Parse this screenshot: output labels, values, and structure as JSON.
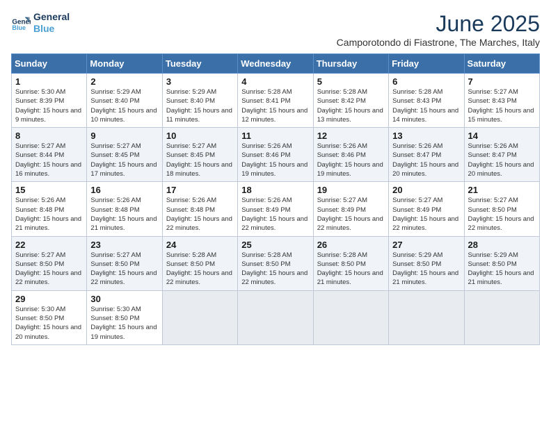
{
  "logo": {
    "line1": "General",
    "line2": "Blue"
  },
  "calendar": {
    "title": "June 2025",
    "subtitle": "Camporotondo di Fiastrone, The Marches, Italy"
  },
  "headers": [
    "Sunday",
    "Monday",
    "Tuesday",
    "Wednesday",
    "Thursday",
    "Friday",
    "Saturday"
  ],
  "weeks": [
    [
      {
        "day": "1",
        "sunrise": "Sunrise: 5:30 AM",
        "sunset": "Sunset: 8:39 PM",
        "daylight": "Daylight: 15 hours and 9 minutes."
      },
      {
        "day": "2",
        "sunrise": "Sunrise: 5:29 AM",
        "sunset": "Sunset: 8:40 PM",
        "daylight": "Daylight: 15 hours and 10 minutes."
      },
      {
        "day": "3",
        "sunrise": "Sunrise: 5:29 AM",
        "sunset": "Sunset: 8:40 PM",
        "daylight": "Daylight: 15 hours and 11 minutes."
      },
      {
        "day": "4",
        "sunrise": "Sunrise: 5:28 AM",
        "sunset": "Sunset: 8:41 PM",
        "daylight": "Daylight: 15 hours and 12 minutes."
      },
      {
        "day": "5",
        "sunrise": "Sunrise: 5:28 AM",
        "sunset": "Sunset: 8:42 PM",
        "daylight": "Daylight: 15 hours and 13 minutes."
      },
      {
        "day": "6",
        "sunrise": "Sunrise: 5:28 AM",
        "sunset": "Sunset: 8:43 PM",
        "daylight": "Daylight: 15 hours and 14 minutes."
      },
      {
        "day": "7",
        "sunrise": "Sunrise: 5:27 AM",
        "sunset": "Sunset: 8:43 PM",
        "daylight": "Daylight: 15 hours and 15 minutes."
      }
    ],
    [
      {
        "day": "8",
        "sunrise": "Sunrise: 5:27 AM",
        "sunset": "Sunset: 8:44 PM",
        "daylight": "Daylight: 15 hours and 16 minutes."
      },
      {
        "day": "9",
        "sunrise": "Sunrise: 5:27 AM",
        "sunset": "Sunset: 8:45 PM",
        "daylight": "Daylight: 15 hours and 17 minutes."
      },
      {
        "day": "10",
        "sunrise": "Sunrise: 5:27 AM",
        "sunset": "Sunset: 8:45 PM",
        "daylight": "Daylight: 15 hours and 18 minutes."
      },
      {
        "day": "11",
        "sunrise": "Sunrise: 5:26 AM",
        "sunset": "Sunset: 8:46 PM",
        "daylight": "Daylight: 15 hours and 19 minutes."
      },
      {
        "day": "12",
        "sunrise": "Sunrise: 5:26 AM",
        "sunset": "Sunset: 8:46 PM",
        "daylight": "Daylight: 15 hours and 19 minutes."
      },
      {
        "day": "13",
        "sunrise": "Sunrise: 5:26 AM",
        "sunset": "Sunset: 8:47 PM",
        "daylight": "Daylight: 15 hours and 20 minutes."
      },
      {
        "day": "14",
        "sunrise": "Sunrise: 5:26 AM",
        "sunset": "Sunset: 8:47 PM",
        "daylight": "Daylight: 15 hours and 20 minutes."
      }
    ],
    [
      {
        "day": "15",
        "sunrise": "Sunrise: 5:26 AM",
        "sunset": "Sunset: 8:48 PM",
        "daylight": "Daylight: 15 hours and 21 minutes."
      },
      {
        "day": "16",
        "sunrise": "Sunrise: 5:26 AM",
        "sunset": "Sunset: 8:48 PM",
        "daylight": "Daylight: 15 hours and 21 minutes."
      },
      {
        "day": "17",
        "sunrise": "Sunrise: 5:26 AM",
        "sunset": "Sunset: 8:48 PM",
        "daylight": "Daylight: 15 hours and 22 minutes."
      },
      {
        "day": "18",
        "sunrise": "Sunrise: 5:26 AM",
        "sunset": "Sunset: 8:49 PM",
        "daylight": "Daylight: 15 hours and 22 minutes."
      },
      {
        "day": "19",
        "sunrise": "Sunrise: 5:27 AM",
        "sunset": "Sunset: 8:49 PM",
        "daylight": "Daylight: 15 hours and 22 minutes."
      },
      {
        "day": "20",
        "sunrise": "Sunrise: 5:27 AM",
        "sunset": "Sunset: 8:49 PM",
        "daylight": "Daylight: 15 hours and 22 minutes."
      },
      {
        "day": "21",
        "sunrise": "Sunrise: 5:27 AM",
        "sunset": "Sunset: 8:50 PM",
        "daylight": "Daylight: 15 hours and 22 minutes."
      }
    ],
    [
      {
        "day": "22",
        "sunrise": "Sunrise: 5:27 AM",
        "sunset": "Sunset: 8:50 PM",
        "daylight": "Daylight: 15 hours and 22 minutes."
      },
      {
        "day": "23",
        "sunrise": "Sunrise: 5:27 AM",
        "sunset": "Sunset: 8:50 PM",
        "daylight": "Daylight: 15 hours and 22 minutes."
      },
      {
        "day": "24",
        "sunrise": "Sunrise: 5:28 AM",
        "sunset": "Sunset: 8:50 PM",
        "daylight": "Daylight: 15 hours and 22 minutes."
      },
      {
        "day": "25",
        "sunrise": "Sunrise: 5:28 AM",
        "sunset": "Sunset: 8:50 PM",
        "daylight": "Daylight: 15 hours and 22 minutes."
      },
      {
        "day": "26",
        "sunrise": "Sunrise: 5:28 AM",
        "sunset": "Sunset: 8:50 PM",
        "daylight": "Daylight: 15 hours and 21 minutes."
      },
      {
        "day": "27",
        "sunrise": "Sunrise: 5:29 AM",
        "sunset": "Sunset: 8:50 PM",
        "daylight": "Daylight: 15 hours and 21 minutes."
      },
      {
        "day": "28",
        "sunrise": "Sunrise: 5:29 AM",
        "sunset": "Sunset: 8:50 PM",
        "daylight": "Daylight: 15 hours and 21 minutes."
      }
    ],
    [
      {
        "day": "29",
        "sunrise": "Sunrise: 5:30 AM",
        "sunset": "Sunset: 8:50 PM",
        "daylight": "Daylight: 15 hours and 20 minutes."
      },
      {
        "day": "30",
        "sunrise": "Sunrise: 5:30 AM",
        "sunset": "Sunset: 8:50 PM",
        "daylight": "Daylight: 15 hours and 19 minutes."
      },
      null,
      null,
      null,
      null,
      null
    ]
  ]
}
